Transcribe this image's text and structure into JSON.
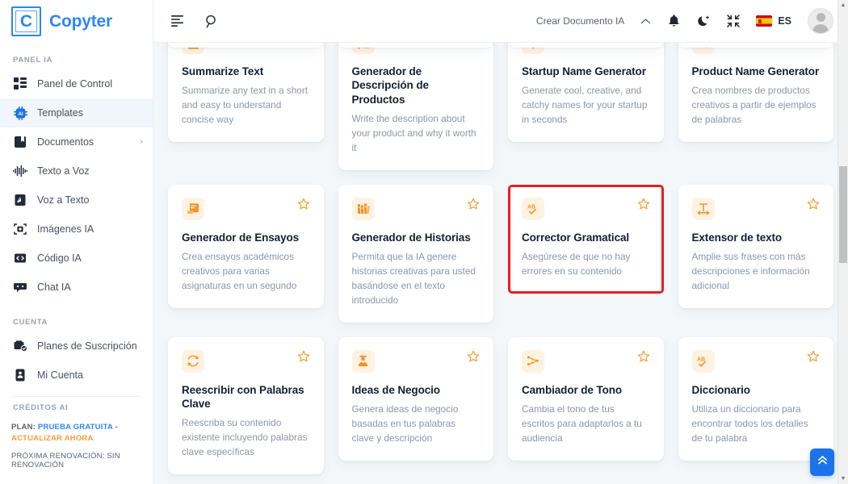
{
  "brand": {
    "mark": "C",
    "name": "Copyter"
  },
  "sidebar": {
    "sections": [
      {
        "heading": "PANEL IA",
        "items": [
          {
            "label": "Panel de Control",
            "icon": "dashboard-icon",
            "active": false,
            "chevron": ""
          },
          {
            "label": "Templates",
            "icon": "ai-chip-icon",
            "active": true,
            "chevron": ""
          },
          {
            "label": "Documentos",
            "icon": "document-icon",
            "active": false,
            "chevron": "›"
          },
          {
            "label": "Texto a Voz",
            "icon": "waveform-icon",
            "active": false,
            "chevron": ""
          },
          {
            "label": "Voz a Texto",
            "icon": "audio-file-icon",
            "active": false,
            "chevron": ""
          },
          {
            "label": "Imágenes IA",
            "icon": "image-icon",
            "active": false,
            "chevron": ""
          },
          {
            "label": "Código IA",
            "icon": "code-icon",
            "active": false,
            "chevron": ""
          },
          {
            "label": "Chat IA",
            "icon": "chat-icon",
            "active": false,
            "chevron": ""
          }
        ]
      },
      {
        "heading": "CUENTA",
        "items": [
          {
            "label": "Planes de Suscripción",
            "icon": "subscription-icon",
            "active": false,
            "chevron": ""
          },
          {
            "label": "Mi Cuenta",
            "icon": "account-icon",
            "active": false,
            "chevron": ""
          }
        ]
      }
    ],
    "credits": {
      "heading": "CRÉDITOS AI",
      "plan_prefix": "PLAN:",
      "plan_name": "PRUEBA GRATUITA",
      "plan_sep": "-",
      "plan_action": "ACTUALIZAR AHORA",
      "renewal": "PRÓXIMA RENOVACIÓN: SIN RENOVACIÓN"
    }
  },
  "topbar": {
    "menu_icon": "menu-icon",
    "search_icon": "search-icon",
    "create_document": "Crear Documento IA",
    "caret": "⌃",
    "notification_icon": "bell-icon",
    "theme_icon": "moon-icon",
    "fullscreen_icon": "fullscreen-icon",
    "language": "ES",
    "avatar": "user-avatar"
  },
  "cards": [
    {
      "title": "Summarize Text",
      "desc": "Summarize any text in a short and easy to understand concise way",
      "icon": "summarize-doc-icon",
      "starred": false,
      "highlight": false
    },
    {
      "title": "Generador de Descripción de Productos",
      "desc": "Write the description about your product and why it worth it",
      "icon": "checklist-icon",
      "starred": false,
      "highlight": false
    },
    {
      "title": "Startup Name Generator",
      "desc": "Generate cool, creative, and catchy names for your startup in seconds",
      "icon": "lightbulb-icon",
      "starred": false,
      "highlight": false
    },
    {
      "title": "Product Name Generator",
      "desc": "Crea nombres de productos creativos a partir de ejemplos de palabras",
      "icon": "product-box-icon",
      "starred": false,
      "highlight": false
    },
    {
      "title": "Generador de Ensayos",
      "desc": "Crea ensayos académicos creativos para varias asignaturas en un segundo",
      "icon": "scroll-icon",
      "starred": false,
      "highlight": false
    },
    {
      "title": "Generador de Historias",
      "desc": "Permita que la IA genere historias creativas para usted basándose en el texto introducido",
      "icon": "books-icon",
      "starred": false,
      "highlight": false
    },
    {
      "title": "Corrector Gramatical",
      "desc": "Asegúrese de que no hay errores en su contenido",
      "icon": "spellcheck-icon",
      "starred": false,
      "highlight": true
    },
    {
      "title": "Extensor de texto",
      "desc": "Amplie sus frases con más descripciones e información adicional",
      "icon": "text-expand-icon",
      "starred": false,
      "highlight": false
    },
    {
      "title": "Reescribir con Palabras Clave",
      "desc": "Reescriba su contenido existente incluyendo palabras clave específicas",
      "icon": "refresh-icon",
      "starred": false,
      "highlight": false
    },
    {
      "title": "Ideas de Negocio",
      "desc": "Genera ideas de negocio basadas en tus palabras clave y descripción",
      "icon": "business-person-icon",
      "starred": false,
      "highlight": false
    },
    {
      "title": "Cambiador de Tono",
      "desc": "Cambia el tono de tus escritos para adaptarlos a tu audiencia",
      "icon": "tone-icon",
      "starred": false,
      "highlight": false
    },
    {
      "title": "Diccionario",
      "desc": "Utiliza un diccionario para encontrar todos los detalles de tu palabra",
      "icon": "spellcheck-icon",
      "starred": false,
      "highlight": false
    }
  ],
  "scroll_top_button": {
    "icon": "chevron-double-up-icon"
  },
  "colors": {
    "brand_blue": "#2f86f6",
    "accent_orange": "#f59324",
    "highlight_red": "#ed1c24",
    "content_bg": "#f4f7fa",
    "active_nav_bg": "#f1f6fd"
  }
}
